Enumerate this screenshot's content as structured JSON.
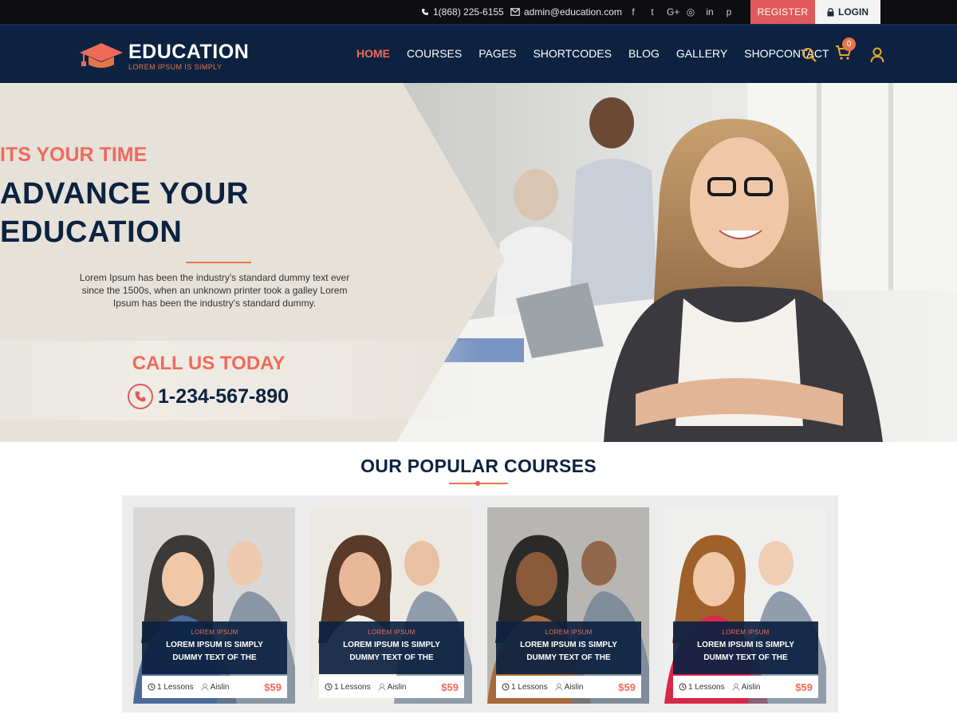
{
  "topbar": {
    "phone": "1(868) 225-6155",
    "email": "admin@education.com",
    "socials": [
      "facebook-icon",
      "twitter-icon",
      "google-plus-icon",
      "instagram-icon",
      "linkedin-icon",
      "pinterest-icon"
    ],
    "social_glyphs": [
      "f",
      "t",
      "G+",
      "◎",
      "in",
      "p"
    ],
    "register": "REGISTER",
    "login": "LOGIN"
  },
  "logo": {
    "title": "EDUCATION",
    "subtitle": "LOREM IPSUM IS SIMPLY"
  },
  "nav": [
    {
      "label": "HOME",
      "active": true
    },
    {
      "label": "COURSES"
    },
    {
      "label": "PAGES"
    },
    {
      "label": "SHORTCODES"
    },
    {
      "label": "BLOG"
    },
    {
      "label": "GALLERY"
    },
    {
      "label": "SHOPCONTACT"
    }
  ],
  "cart_count": "0",
  "hero": {
    "kicker": "ITS YOUR TIME",
    "headline_1": "ADVANCE YOUR",
    "headline_2": "EDUCATION",
    "lead": "Lorem Ipsum has been the industry's standard dummy text ever since the 1500s, when an unknown printer took a galley Lorem Ipsum has been the industry's standard dummy.",
    "call_title": "CALL US TODAY",
    "call_phone": "1-234-567-890"
  },
  "section_title": "OUR POPULAR COURSES",
  "courses": [
    {
      "tag": "LOREM IPSUM",
      "title": "LOREM IPSUM IS SIMPLY DUMMY TEXT OF THE",
      "lessons": "1 Lessons",
      "author": "Aislin",
      "price": "$59"
    },
    {
      "tag": "LOREM IPSUM",
      "title": "LOREM IPSUM IS SIMPLY DUMMY TEXT OF THE",
      "lessons": "1 Lessons",
      "author": "Aislin",
      "price": "$59"
    },
    {
      "tag": "LOREM IPSUM",
      "title": "LOREM IPSUM IS SIMPLY DUMMY TEXT OF THE",
      "lessons": "1 Lessons",
      "author": "Aislin",
      "price": "$59"
    },
    {
      "tag": "LOREM IPSUM",
      "title": "LOREM IPSUM IS SIMPLY DUMMY TEXT OF THE",
      "lessons": "1 Lessons",
      "author": "Aislin",
      "price": "$59"
    }
  ],
  "colors": {
    "navy": "#0c2240",
    "accent": "#f06a5a",
    "orange": "#e8754a",
    "topbar": "#0e0e10"
  }
}
